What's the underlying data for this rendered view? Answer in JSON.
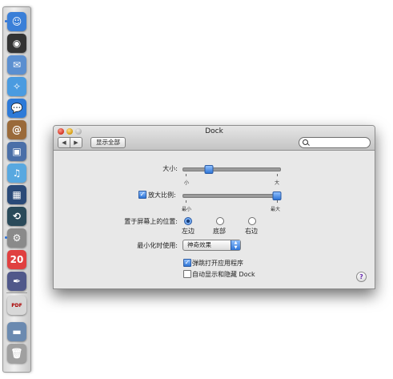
{
  "dock": {
    "items": [
      {
        "name": "finder",
        "glyph": "☺",
        "color": "#3a7fd8"
      },
      {
        "name": "dashboard",
        "glyph": "◉",
        "color": "#333333"
      },
      {
        "name": "mail",
        "glyph": "✉",
        "color": "#5b8fd0"
      },
      {
        "name": "safari",
        "glyph": "✧",
        "color": "#4a9be0"
      },
      {
        "name": "ichat",
        "glyph": "💬",
        "color": "#2d7ad8"
      },
      {
        "name": "address-book",
        "glyph": "@",
        "color": "#9a6a3a"
      },
      {
        "name": "iphoto",
        "glyph": "▣",
        "color": "#4a6fa8"
      },
      {
        "name": "itunes",
        "glyph": "♫",
        "color": "#58a8e0"
      },
      {
        "name": "spaces",
        "glyph": "▦",
        "color": "#2a4a78"
      },
      {
        "name": "time-machine",
        "glyph": "⟲",
        "color": "#2a4a5a"
      },
      {
        "name": "system-preferences",
        "glyph": "⚙",
        "color": "#8a8a8a"
      },
      {
        "name": "ical",
        "glyph": "20",
        "color": "#e04040"
      },
      {
        "name": "script-editor",
        "glyph": "✒",
        "color": "#50588a"
      },
      {
        "name": "pdf-document",
        "glyph": "PDF",
        "color": "#d8d8d8"
      },
      {
        "name": "folder",
        "glyph": "▬",
        "color": "#6b8ab0"
      },
      {
        "name": "trash",
        "glyph": "🗑",
        "color": "#a0a0a0"
      }
    ]
  },
  "window": {
    "title": "Dock",
    "show_all": "显示全部",
    "search": {
      "placeholder": "",
      "value": ""
    },
    "back_glyph": "◀",
    "forward_glyph": "▶"
  },
  "settings": {
    "size": {
      "label": "大小:",
      "min_label": "小",
      "max_label": "大",
      "value": 0.25
    },
    "magnification": {
      "label": "放大比例:",
      "checked": true,
      "min_label": "最小",
      "max_label": "最大",
      "value": 1.0
    },
    "position": {
      "label": "置于屏幕上的位置:",
      "options": [
        {
          "label": "左边",
          "selected": true
        },
        {
          "label": "底部",
          "selected": false
        },
        {
          "label": "右边",
          "selected": false
        }
      ]
    },
    "minimize": {
      "label": "最小化时使用:",
      "selected": "神奇效果"
    },
    "animate": {
      "label": "弹跳打开应用程序",
      "checked": true
    },
    "autohide": {
      "label": "自动显示和隐藏 Dock",
      "checked": false
    }
  },
  "help": {
    "glyph": "?"
  },
  "colors": {
    "accent": "#2f75d6",
    "window_bg": "#e8e8e8"
  }
}
